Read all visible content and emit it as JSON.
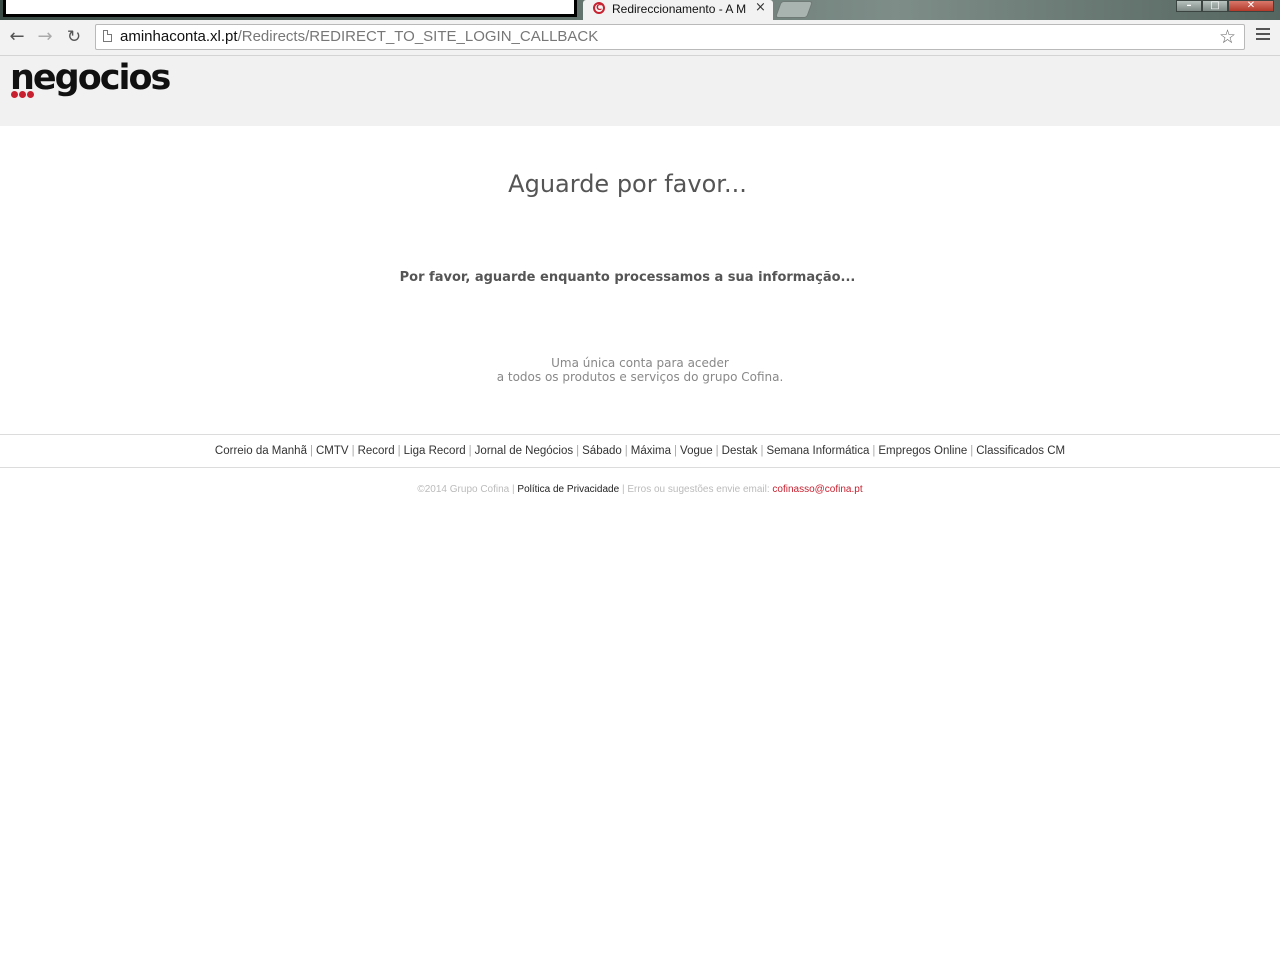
{
  "browser": {
    "tab_title": "Redireccionamento - A M",
    "tab_close": "×",
    "url_host": "aminhaconta.xl.pt",
    "url_path": "/Redirects/REDIRECT_TO_SITE_LOGIN_CALLBACK",
    "win_minimize": "–",
    "win_maximize": "□",
    "win_close": "✕"
  },
  "header": {
    "logo_text": "negocios"
  },
  "main": {
    "heading": "Aguarde por favor...",
    "message": "Por favor, aguarde enquanto processamos a sua informação...",
    "tagline_line1": "Uma única conta para aceder",
    "tagline_line2": "a todos os produtos e serviços do grupo Cofina."
  },
  "footer": {
    "links": [
      "Correio da Manhã",
      "CMTV",
      "Record",
      "Liga Record",
      "Jornal de Negócios",
      "Sábado",
      "Máxima",
      "Vogue",
      "Destak",
      "Semana Informática",
      "Empregos Online",
      "Classificados CM"
    ],
    "separator": "|",
    "copyright": "©2014 Grupo Cofina",
    "privacy": "Política de Privacidade",
    "feedback": "Erros ou sugestões envie email:",
    "email": "cofinasso@cofina.pt"
  },
  "colors": {
    "brand_red": "#c8202f",
    "header_bg": "#f1f1f1",
    "text_gray": "#555555"
  }
}
